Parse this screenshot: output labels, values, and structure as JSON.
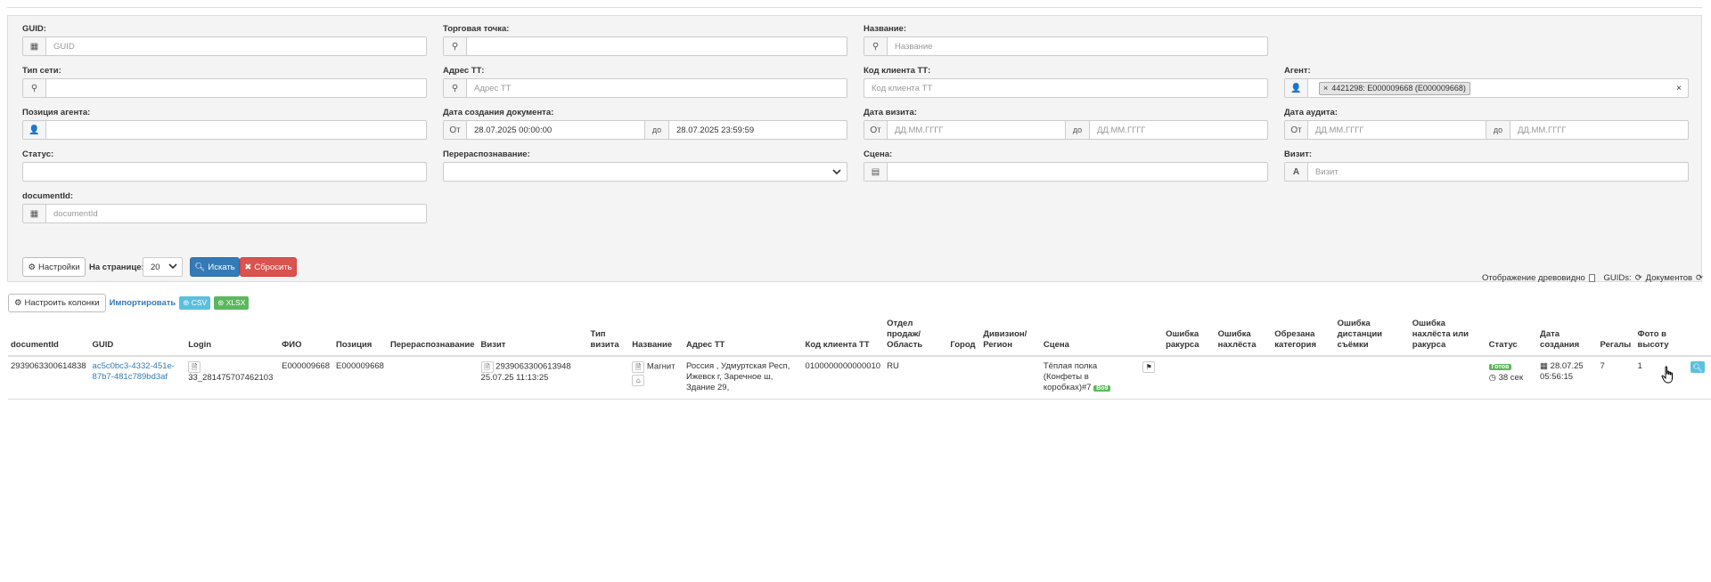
{
  "filters": {
    "guid": {
      "label": "GUID:",
      "placeholder": "GUID",
      "icon": "grid-icon"
    },
    "trade_point": {
      "label": "Торговая точка:",
      "placeholder": "",
      "icon": "map-marker-icon"
    },
    "name": {
      "label": "Название:",
      "placeholder": "Название",
      "icon": "map-marker-icon"
    },
    "network_type": {
      "label": "Тип сети:",
      "placeholder": "",
      "icon": "map-marker-icon"
    },
    "tt_address": {
      "label": "Адрес ТТ:",
      "placeholder": "Адрес ТТ",
      "icon": "map-marker-icon"
    },
    "tt_client_code": {
      "label": "Код клиента ТТ:",
      "placeholder": "Код клиента ТТ"
    },
    "agent": {
      "label": "Агент:",
      "tag": "4421298: E000009668 (E000009668)",
      "icon": "user-icon"
    },
    "agent_position": {
      "label": "Позиция агента:",
      "placeholder": "",
      "icon": "user-icon"
    },
    "doc_created": {
      "label": "Дата создания документа:",
      "from_label": "От",
      "to_label": "до",
      "from": "28.07.2025 00:00:00",
      "to": "28.07.2025 23:59:59"
    },
    "visit_date": {
      "label": "Дата визита:",
      "from_label": "От",
      "to_label": "до",
      "from_ph": "ДД.ММ.ГГГГ",
      "to_ph": "ДД.ММ.ГГГГ"
    },
    "audit_date": {
      "label": "Дата аудита:",
      "from_label": "От",
      "to_label": "до",
      "from_ph": "ДД.ММ.ГГГГ",
      "to_ph": "ДД.ММ.ГГГГ"
    },
    "status": {
      "label": "Статус:"
    },
    "rerecognition": {
      "label": "Перераспознавание:"
    },
    "scene": {
      "label": "Сцена:",
      "icon": "calendar-icon"
    },
    "visit": {
      "label": "Визит:",
      "placeholder": "Визит",
      "icon": "font-icon"
    },
    "document_id": {
      "label": "documentId:",
      "placeholder": "documentId",
      "icon": "grid-icon"
    }
  },
  "actions": {
    "settings": "Настройки",
    "per_page_label": "На странице:",
    "per_page_value": "20",
    "search": "Искать",
    "reset": "Сбросить",
    "tree_view": "Отображение древовидно",
    "guids": "GUIDs:",
    "documents": "Документов"
  },
  "table_tools": {
    "configure_columns": "Настроить колонки",
    "import": "Импортировать",
    "csv": "CSV",
    "xlsx": "XLSX"
  },
  "columns": [
    "documentId",
    "GUID",
    "Login",
    "ФИО",
    "Позиция",
    "Перераспознавание",
    "Визит",
    "Тип визита",
    "Название",
    "Адрес ТТ",
    "Код клиента ТТ",
    "Отдел продаж/ Область",
    "Город",
    "Дивизион/ Регион",
    "Сцена",
    "",
    "Ошибка ракурса",
    "Ошибка нахлёста",
    "Обрезана категория",
    "Ошибка дистанции съёмки",
    "Ошибка нахлёста или ракурса",
    "Статус",
    "Дата создания",
    "Регалы",
    "Фото в высоту"
  ],
  "row": {
    "documentId": "2939063300614838",
    "guid": "ac5c0bc3-4332-451e-87b7-481c789bd3af",
    "login": "33_281475707462103",
    "fio": "E000009668",
    "position": "E000009668",
    "visit_id": "2939063300613948",
    "visit_date": "25.07.25 11:13:25",
    "name": "Магнит",
    "address": "Россия , Удмуртская Респ, Ижевск г, Заречное ш, Здание 29,",
    "client_code": "0100000000000010",
    "sales_dept": "RU",
    "scene": "Тёплая полка (Конфеты в коробках)#7",
    "scene_badge": "Bo9",
    "status_badge": "Готов",
    "status_time": "38 сек",
    "created": "28.07.25 05:56:15",
    "shelves": "7",
    "photo_height": "1"
  }
}
